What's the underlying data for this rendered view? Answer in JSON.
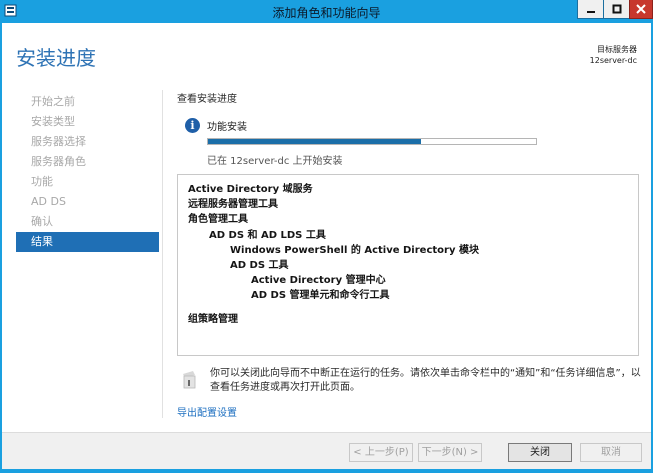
{
  "window": {
    "title": "添加角色和功能向导"
  },
  "header": {
    "page_title": "安装进度",
    "target_label": "目标服务器",
    "target_value": "12server-dc"
  },
  "nav": {
    "items": [
      {
        "label": "开始之前",
        "active": false
      },
      {
        "label": "安装类型",
        "active": false
      },
      {
        "label": "服务器选择",
        "active": false
      },
      {
        "label": "服务器角色",
        "active": false
      },
      {
        "label": "功能",
        "active": false
      },
      {
        "label": "AD DS",
        "active": false
      },
      {
        "label": "确认",
        "active": false
      },
      {
        "label": "结果",
        "active": true
      }
    ]
  },
  "main": {
    "section_label": "查看安装进度",
    "feature_install": "功能安装",
    "progress_fraction": 0.65,
    "status": "已在 12server-dc 上开始安装",
    "results": [
      {
        "text": "Active Directory 域服务",
        "level": 0
      },
      {
        "text": "远程服务器管理工具",
        "level": 0
      },
      {
        "text": "角色管理工具",
        "level": 1
      },
      {
        "text": "AD DS 和 AD LDS 工具",
        "level": 2
      },
      {
        "text": "Windows PowerShell 的 Active Directory 模块",
        "level": 3
      },
      {
        "text": "AD DS 工具",
        "level": 3
      },
      {
        "text": "Active Directory 管理中心",
        "level": 4
      },
      {
        "text": "AD DS 管理单元和命令行工具",
        "level": 4
      },
      {
        "text": "组策略管理",
        "level": 0,
        "gap": true
      }
    ],
    "note": "你可以关闭此向导而不中断正在运行的任务。请依次单击命令栏中的“通知”和“任务详细信息”，以查看任务进度或再次打开此页面。",
    "export_link": "导出配置设置"
  },
  "footer": {
    "prev": "< 上一步(P)",
    "next": "下一步(N) >",
    "close": "关闭",
    "cancel": "取消"
  },
  "colors": {
    "titlebar": "#1aa0e0",
    "accent": "#1f6fb5",
    "progress": "#1b6ea8",
    "link": "#1d6fc0"
  }
}
